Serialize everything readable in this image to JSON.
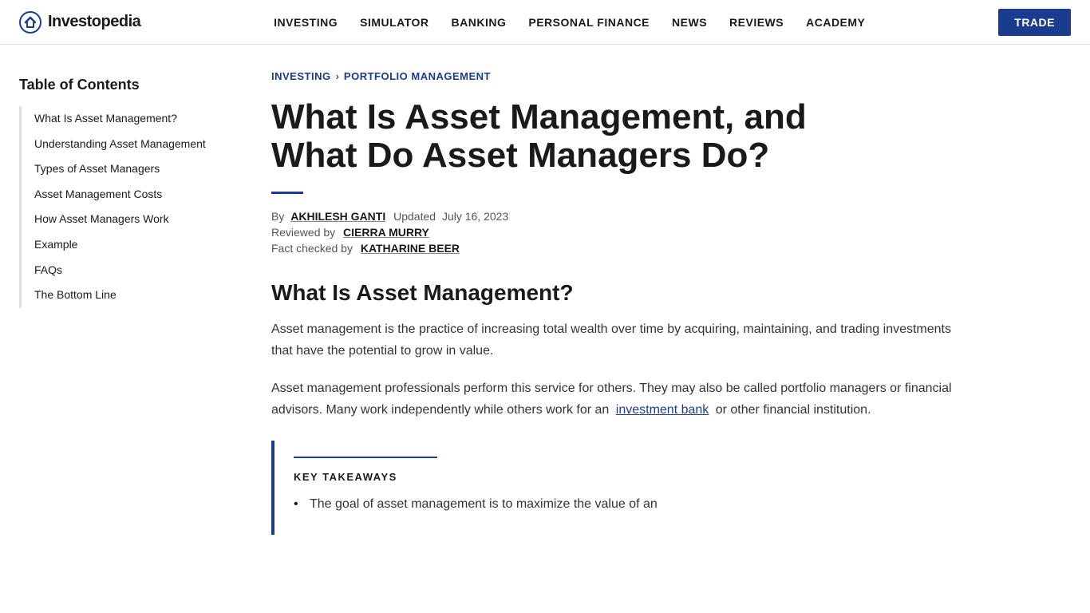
{
  "header": {
    "logo_text": "Investopedia",
    "nav_items": [
      {
        "label": "INVESTING",
        "id": "investing"
      },
      {
        "label": "SIMULATOR",
        "id": "simulator"
      },
      {
        "label": "BANKING",
        "id": "banking"
      },
      {
        "label": "PERSONAL FINANCE",
        "id": "personal-finance"
      },
      {
        "label": "NEWS",
        "id": "news"
      },
      {
        "label": "REVIEWS",
        "id": "reviews"
      },
      {
        "label": "ACADEMY",
        "id": "academy"
      }
    ],
    "trade_button": "TRADE"
  },
  "breadcrumb": {
    "parent": "INVESTING",
    "separator": "›",
    "current": "PORTFOLIO MANAGEMENT"
  },
  "article": {
    "title": "What Is Asset Management, and What Do Asset Managers Do?",
    "author_label": "By",
    "author_name": "AKHILESH GANTI",
    "updated_label": "Updated",
    "updated_date": "July 16, 2023",
    "reviewed_label": "Reviewed by",
    "reviewer_name": "CIERRA MURRY",
    "fact_checked_label": "Fact checked by",
    "fact_checker_name": "KATHARINE BEER"
  },
  "toc": {
    "title": "Table of Contents",
    "items": [
      {
        "label": "What Is Asset Management?",
        "id": "what-is"
      },
      {
        "label": "Understanding Asset Management",
        "id": "understanding"
      },
      {
        "label": "Types of Asset Managers",
        "id": "types"
      },
      {
        "label": "Asset Management Costs",
        "id": "costs"
      },
      {
        "label": "How Asset Managers Work",
        "id": "how"
      },
      {
        "label": "Example",
        "id": "example"
      },
      {
        "label": "FAQs",
        "id": "faqs"
      },
      {
        "label": "The Bottom Line",
        "id": "bottom-line"
      }
    ]
  },
  "section_what_is": {
    "heading": "What Is Asset Management?",
    "paragraph1": "Asset management is the practice of increasing total wealth over time by acquiring, maintaining, and trading investments that have the potential to grow in value.",
    "paragraph2": "Asset management professionals perform this service for others. They may also be called portfolio managers or financial advisors. Many work independently while others work for an",
    "link_text": "investment bank",
    "paragraph2_end": "or other financial institution."
  },
  "key_takeaways": {
    "title": "KEY TAKEAWAYS",
    "items": [
      "The goal of asset management is to maximize the value of an"
    ]
  },
  "colors": {
    "brand_blue": "#1a3c8f",
    "link_blue": "#1a3c8f",
    "text_dark": "#1a1a1a",
    "text_body": "#333",
    "text_muted": "#555"
  }
}
